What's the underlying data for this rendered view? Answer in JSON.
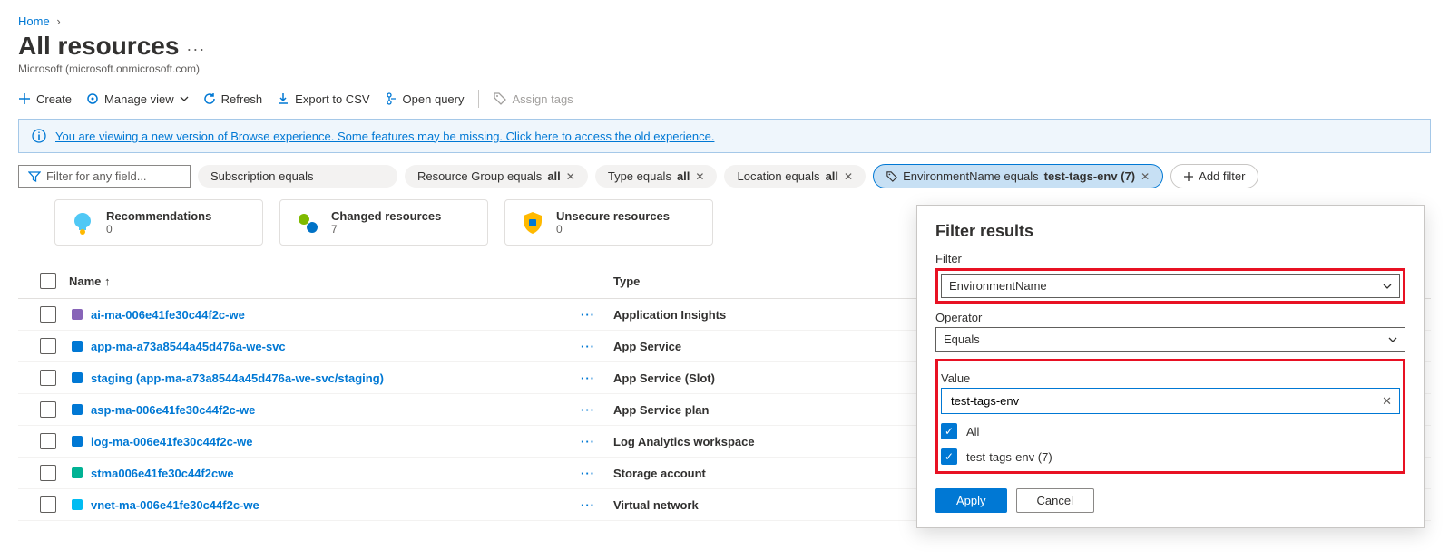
{
  "breadcrumb": {
    "home": "Home"
  },
  "page": {
    "title": "All resources",
    "org": "Microsoft (microsoft.onmicrosoft.com)"
  },
  "toolbar": {
    "create": "Create",
    "manage_view": "Manage view",
    "refresh": "Refresh",
    "export": "Export to CSV",
    "open_query": "Open query",
    "assign_tags": "Assign tags"
  },
  "info_bar": {
    "text": "You are viewing a new version of Browse experience. Some features may be missing. Click here to access the old experience."
  },
  "filters": {
    "search_placeholder": "Filter for any field...",
    "pills": {
      "subscription": "Subscription equals",
      "rg_prefix": "Resource Group equals ",
      "rg_value": "all",
      "type_prefix": "Type equals ",
      "type_value": "all",
      "location_prefix": "Location equals ",
      "location_value": "all",
      "env_prefix": "EnvironmentName equals ",
      "env_value": "test-tags-env (7)",
      "add": "Add filter"
    }
  },
  "cards": {
    "recs_t": "Recommendations",
    "recs_v": "0",
    "chg_t": "Changed resources",
    "chg_v": "7",
    "unsec_t": "Unsecure resources",
    "unsec_v": "0"
  },
  "table": {
    "col_name": "Name ↑",
    "col_type": "Type",
    "rows": [
      {
        "icon_color": "#8764b8",
        "name": "ai-ma-006e41fe30c44f2c-we",
        "type": "Application Insights"
      },
      {
        "icon_color": "#0078d4",
        "name": "app-ma-a73a8544a45d476a-we-svc",
        "type": "App Service"
      },
      {
        "icon_color": "#0078d4",
        "name": "staging (app-ma-a73a8544a45d476a-we-svc/staging)",
        "type": "App Service (Slot)"
      },
      {
        "icon_color": "#0078d4",
        "name": "asp-ma-006e41fe30c44f2c-we",
        "type": "App Service plan"
      },
      {
        "icon_color": "#0078d4",
        "name": "log-ma-006e41fe30c44f2c-we",
        "type": "Log Analytics workspace"
      },
      {
        "icon_color": "#00b294",
        "name": "stma006e41fe30c44f2cwe",
        "type": "Storage account"
      },
      {
        "icon_color": "#00bcf2",
        "name": "vnet-ma-006e41fe30c44f2c-we",
        "type": "Virtual network"
      }
    ]
  },
  "popout": {
    "title": "Filter results",
    "filter_label": "Filter",
    "filter_value": "EnvironmentName",
    "op_label": "Operator",
    "op_value": "Equals",
    "value_label": "Value",
    "value_text": "test-tags-env",
    "opt_all": "All",
    "opt_sel": "test-tags-env (7)",
    "apply": "Apply",
    "cancel": "Cancel"
  }
}
